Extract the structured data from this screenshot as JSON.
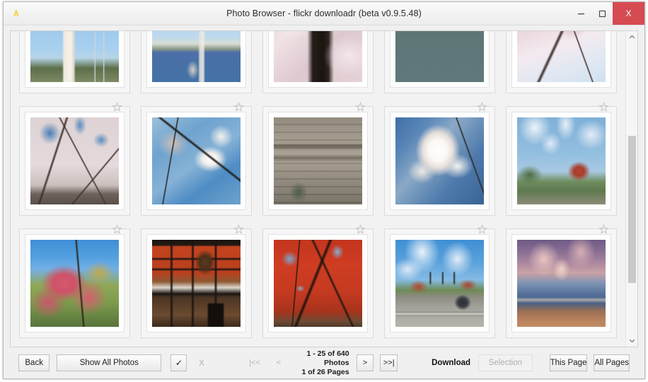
{
  "window": {
    "title": "Photo Browser - flickr downloadr (beta v0.9.5.48)",
    "app_icon": "flickr-downloadr-icon",
    "controls": {
      "minimize": "minimize-icon",
      "maximize": "maximize-icon",
      "close": "X",
      "close_color": "#d64b52"
    }
  },
  "gallery": {
    "star_icon": "star-outline-icon",
    "rows": [
      {
        "cells": [
          {
            "name": "thumbnail-washington-monument-cranes",
            "favorite": false
          },
          {
            "name": "thumbnail-monument-across-tidal-basin",
            "favorite": false
          },
          {
            "name": "thumbnail-cherry-blossom-trunk",
            "favorite": false
          },
          {
            "name": "thumbnail-tidal-basin-water",
            "favorite": false
          },
          {
            "name": "thumbnail-blossoms-overhead",
            "favorite": false
          }
        ]
      },
      {
        "cells": [
          {
            "name": "thumbnail-cherry-blossom-canopy",
            "favorite": false
          },
          {
            "name": "thumbnail-blossom-branch-blue-sky",
            "favorite": false
          },
          {
            "name": "thumbnail-stone-memorial-inscription",
            "favorite": false
          },
          {
            "name": "thumbnail-white-blossom-closeup",
            "favorite": false
          },
          {
            "name": "thumbnail-autumn-tree-cloudy-sky",
            "favorite": false
          }
        ]
      },
      {
        "cells": [
          {
            "name": "thumbnail-red-maple-blue-sky",
            "favorite": false
          },
          {
            "name": "thumbnail-window-interior-autumn",
            "favorite": false
          },
          {
            "name": "thumbnail-red-maple-tree",
            "favorite": false
          },
          {
            "name": "thumbnail-roadside-traffic-lights",
            "favorite": false
          },
          {
            "name": "thumbnail-beach-sunset-clouds",
            "favorite": false
          }
        ]
      }
    ],
    "scrollbar": {
      "up_icon": "chevron-up-icon",
      "down_icon": "chevron-down-icon"
    }
  },
  "toolbar": {
    "back": "Back",
    "show_all_photos": "Show All Photos",
    "select_all": "✓",
    "deselect_all": "X",
    "first_page": "|<<",
    "prev_page": "<",
    "photo_range": "1 - 25 of 640 Photos",
    "page_range": "1 of 26 Pages",
    "next_page": ">",
    "last_page": ">>|",
    "download_label": "Download",
    "selection": "Selection",
    "this_page": "This Page",
    "all_pages": "All Pages"
  }
}
